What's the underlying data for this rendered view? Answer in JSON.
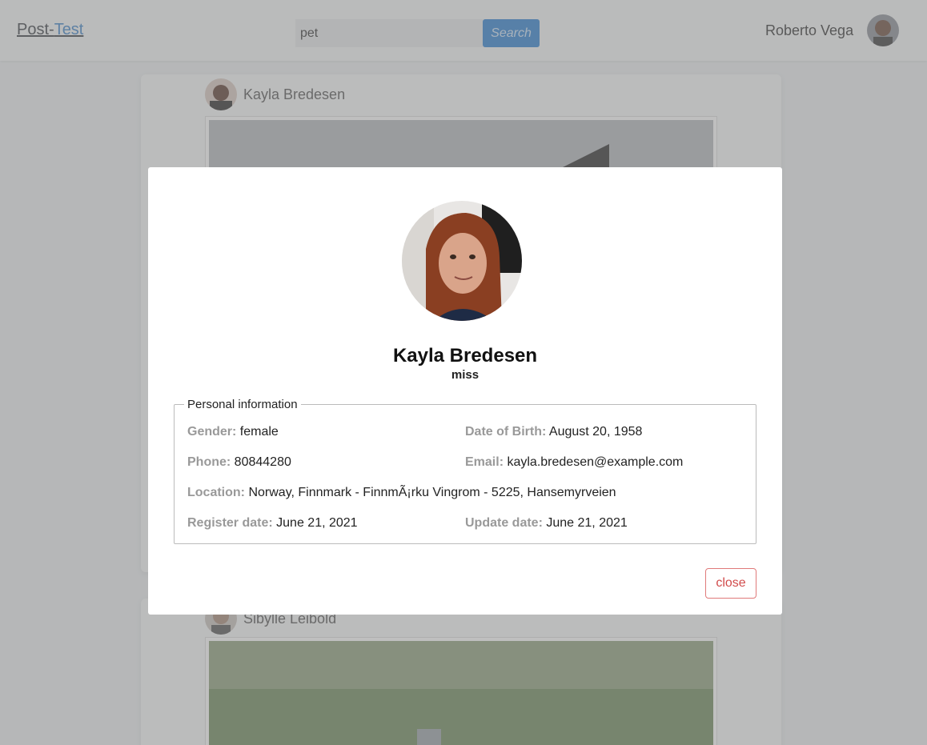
{
  "header": {
    "logo_part1": "Post-",
    "logo_part2": "Test",
    "search_value": "pet",
    "search_button": "Search",
    "user_name": "Roberto Vega"
  },
  "feed": {
    "posts": [
      {
        "author": "Kayla Bredesen"
      },
      {
        "author": "Sibylle Leibold"
      }
    ]
  },
  "modal": {
    "name": "Kayla Bredesen",
    "title": "miss",
    "section_legend": "Personal information",
    "fields": {
      "gender": {
        "label": "Gender:",
        "value": "female"
      },
      "dob": {
        "label": "Date of Birth:",
        "value": "August 20, 1958"
      },
      "phone": {
        "label": "Phone:",
        "value": "80844280"
      },
      "email": {
        "label": "Email:",
        "value": "kayla.bredesen@example.com"
      },
      "location": {
        "label": "Location:",
        "value": "Norway, Finnmark - FinnmÃ¡rku Vingrom - 5225, Hansemyrveien"
      },
      "register": {
        "label": "Register date:",
        "value": "June 21, 2021"
      },
      "update": {
        "label": "Update date:",
        "value": "June 21, 2021"
      }
    },
    "close_label": "close"
  },
  "colors": {
    "accent": "#2f80d0",
    "close": "#d14b4b",
    "label": "#999999"
  }
}
